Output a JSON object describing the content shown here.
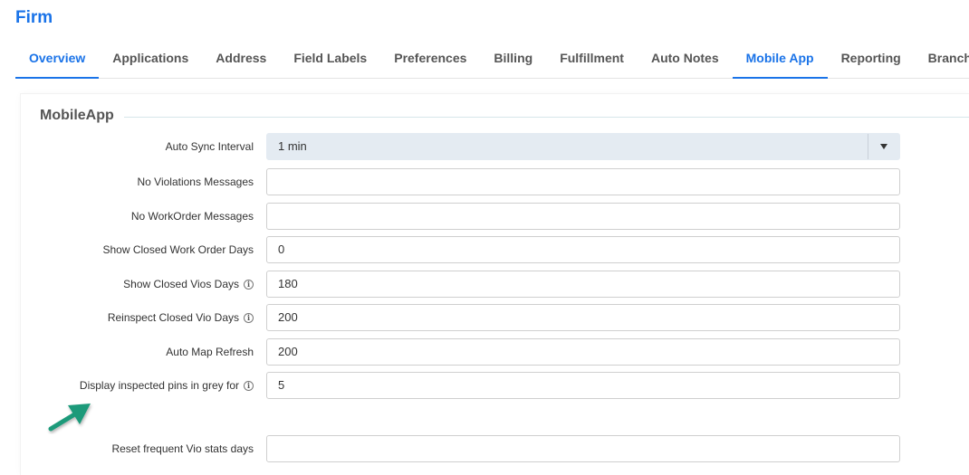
{
  "page": {
    "title": "Firm"
  },
  "tabs": [
    {
      "label": "Overview",
      "active": true
    },
    {
      "label": "Applications",
      "active": false
    },
    {
      "label": "Address",
      "active": false
    },
    {
      "label": "Field Labels",
      "active": false
    },
    {
      "label": "Preferences",
      "active": false
    },
    {
      "label": "Billing",
      "active": false
    },
    {
      "label": "Fulfillment",
      "active": false
    },
    {
      "label": "Auto Notes",
      "active": false
    },
    {
      "label": "Mobile App",
      "active": true
    },
    {
      "label": "Reporting",
      "active": false
    },
    {
      "label": "Branches",
      "active": false
    }
  ],
  "section": {
    "title": "MobileApp"
  },
  "fields": {
    "auto_sync_interval": {
      "label": "Auto Sync Interval",
      "value": "1 min"
    },
    "no_violations_messages": {
      "label": "No Violations Messages",
      "value": ""
    },
    "no_workorder_messages": {
      "label": "No WorkOrder Messages",
      "value": ""
    },
    "show_closed_work_order_days": {
      "label": "Show Closed Work Order Days",
      "value": "0"
    },
    "show_closed_vios_days": {
      "label": "Show Closed Vios Days",
      "value": "180",
      "info": true
    },
    "reinspect_closed_vio_days": {
      "label": "Reinspect Closed Vio Days",
      "value": "200",
      "info": true
    },
    "auto_map_refresh": {
      "label": "Auto Map Refresh",
      "value": "200"
    },
    "display_inspected_pins_grey": {
      "label": "Display inspected pins in grey for",
      "value": "5",
      "info": true
    },
    "reset_frequent_vio_stats_days": {
      "label": "Reset frequent Vio stats days",
      "value": ""
    }
  },
  "icons": {
    "info": "info-icon",
    "dropdown": "chevron-down-icon",
    "annotation": "arrow-icon"
  },
  "colors": {
    "accent": "#1a73e8",
    "annotation_arrow": "#1a9a7a"
  }
}
